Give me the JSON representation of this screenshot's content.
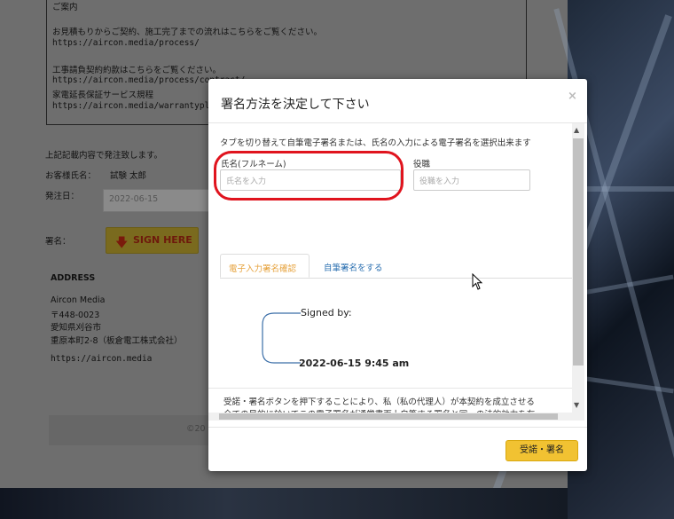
{
  "background": {
    "process_heading": "ご案内",
    "process_text": "お見積もりからご契約、施工完了までの流れはこちらをご覧ください。",
    "process_url": "https://aircon.media/process/",
    "contract_text": "工事請負契約約款はこちらをご覧ください。",
    "contract_url": "https://aircon.media/process/contract/",
    "warranty_text": "家電延長保証サービス規程",
    "warranty_url": "https://aircon.media/warrantyplan/",
    "agree_line": "上記記載内容で発注致します。",
    "customer_label": "お客様氏名：",
    "customer_name": "試験 太郎",
    "order_date_label": "発注日：",
    "order_date_value": "2022-06-15",
    "signature_label": "署名：",
    "sign_here_label": "SIGN HERE",
    "address_heading": "ADDRESS",
    "address_lines": [
      "Aircon Media",
      "〒448-0023",
      "愛知県刈谷市",
      "重原本町2-8（板倉電工株式会社）"
    ],
    "address_url": "https://aircon.media",
    "footer_text": "©20"
  },
  "modal": {
    "title": "署名方法を決定して下さい",
    "close": "×",
    "instruction": "タブを切り替えて自筆電子署名または、氏名の入力による電子署名を選択出来ます",
    "name_label": "氏名(フルネーム)",
    "name_placeholder": "氏名を入力",
    "title_label": "役職",
    "title_placeholder": "役職を入力",
    "tabs": [
      "電子入力署名確認",
      "自筆署名をする"
    ],
    "signed_by": "Signed by:",
    "signed_date": "2022-06-15 9:45 am",
    "agreement_lines": [
      "受諾・署名ボタンを押下することにより、私（私の代理人）が本契約を成立させる",
      "全ての目的に於いてこの電子署名が通常書面上自筆する署名と同一の法的効力を有"
    ],
    "submit_label": "受諾・署名"
  },
  "colors": {
    "accent_yellow": "#f1c232",
    "tab_active": "#e6a23c",
    "tab_link": "#2a6fb0",
    "highlight_red": "#e0141e"
  }
}
